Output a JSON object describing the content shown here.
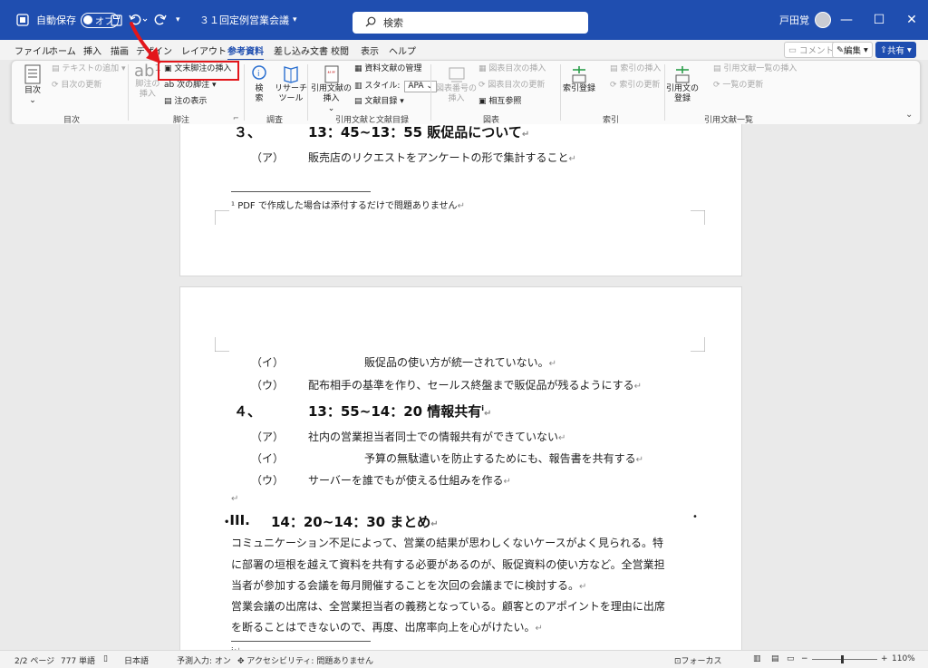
{
  "titlebar": {
    "autosave_label": "自動保存",
    "autosave_state": "オフ",
    "doc_title": "３１回定例営業会議",
    "search_placeholder": "検索",
    "user_name": "戸田覚"
  },
  "tabs": [
    "ファイル",
    "ホーム",
    "挿入",
    "描画",
    "デザイン",
    "レイアウト",
    "参考資料",
    "差し込み文書",
    "校閲",
    "表示",
    "ヘルプ"
  ],
  "active_tab": "参考資料",
  "tab_buttons": {
    "comment": "コメント",
    "edit": "編集",
    "share": "共有"
  },
  "ribbon": {
    "toc": {
      "big": "目次",
      "add_text": "テキストの追加",
      "update": "目次の更新",
      "group": "目次"
    },
    "footnotes": {
      "insert_footnote": "脚注の\n挿入",
      "insert_endnote": "文末脚注の挿入",
      "next_footnote": "次の脚注",
      "show_notes": "注の表示",
      "group": "脚注"
    },
    "research": {
      "search": "検\n索",
      "researcher": "リサーチ\nツール",
      "group": "調査"
    },
    "citations": {
      "insert_citation": "引用文献の\n挿入",
      "manage_sources": "資料文献の管理",
      "style_label": "スタイル:",
      "style_value": "APA",
      "bibliography": "文献目録",
      "group": "引用文献と文献目録"
    },
    "captions": {
      "insert_caption": "図表番号の\n挿入",
      "insert_tof": "図表目次の挿入",
      "update_table": "図表目次の更新",
      "cross_ref": "相互参照",
      "group": "図表"
    },
    "index": {
      "mark_entry": "索引登録",
      "insert_index": "索引の挿入",
      "update_index": "索引の更新",
      "group": "索引"
    },
    "toa": {
      "mark_citation": "引用文の\n登録",
      "insert_toa": "引用文献一覧の挿入",
      "update_toa": "一覧の更新",
      "group": "引用文献一覧"
    }
  },
  "document": {
    "page1": {
      "heading3_num": "３、",
      "heading3": "13：45~13：55 販促品について",
      "item_a_label": "（ア）",
      "item_a": "販売店のリクエストをアンケートの形で集計すること",
      "footnote": "¹ PDF で作成した場合は添付するだけで問題ありません"
    },
    "page2": {
      "i_label": "（イ）",
      "i_text": "販促品の使い方が統一されていない。",
      "u_label": "（ウ）",
      "u_text": "配布相手の基準を作り、セールス終盤まで販促品が残るようにする",
      "heading4_num": "４、",
      "heading4": "13：55~14：20 情報共有",
      "a2_label": "（ア）",
      "a2_text": "社内の営業担当者同士での情報共有ができていない",
      "i2_label": "（イ）",
      "i2_text": "予算の無駄遣いを防止するためにも、報告書を共有する",
      "u2_label": "（ウ）",
      "u2_text": "サーバーを誰でもが使える仕組みを作る",
      "section3_num": "III.",
      "section3": "14：20~14：30 まとめ",
      "para1_l1": "コミュニケーション不足によって、営業の結果が思わしくないケースがよく見られる。特",
      "para1_l2": "に部署の垣根を越えて資料を共有する必要があるのが、販促資料の使い方など。全営業担",
      "para1_l3": "当者が参加する会議を毎月開催することを次回の会議までに検討する。",
      "para2_l1": "営業会議の出席は、全営業担当者の義務となっている。顧客とのアポイントを理由に出席",
      "para2_l2": "を断ることはできないので、再度、出席率向上を心がけたい。",
      "endnote_mark": "i"
    }
  },
  "status": {
    "page": "2/2 ページ",
    "words": "777 単語",
    "lang": "日本語",
    "predict": "予測入力: オン",
    "accessibility": "アクセシビリティ: 問題ありません",
    "focus": "フォーカス",
    "zoom": "110%"
  },
  "colors": {
    "accent": "#1f4eb0",
    "highlight": "#e3161b"
  }
}
